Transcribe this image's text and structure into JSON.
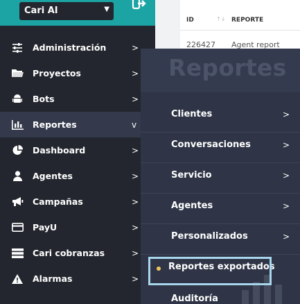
{
  "account": {
    "selected": "Cari AI"
  },
  "sidebar": {
    "items": [
      {
        "label": "Administración",
        "icon": "sliders-icon",
        "arrow": ">"
      },
      {
        "label": "Proyectos",
        "icon": "folder-icon",
        "arrow": ">"
      },
      {
        "label": "Bots",
        "icon": "android-icon",
        "arrow": ">"
      },
      {
        "label": "Reportes",
        "icon": "bar-chart-icon",
        "arrow": "v"
      },
      {
        "label": "Dashboard",
        "icon": "pie-chart-icon",
        "arrow": ">"
      },
      {
        "label": "Agentes",
        "icon": "user-icon",
        "arrow": ">"
      },
      {
        "label": "Campañas",
        "icon": "megaphone-icon",
        "arrow": ">"
      },
      {
        "label": "PayU",
        "icon": "credit-card-icon",
        "arrow": ">"
      },
      {
        "label": "Cari cobranzas",
        "icon": "server-icon",
        "arrow": ">"
      },
      {
        "label": "Alarmas",
        "icon": "warning-icon",
        "arrow": ">"
      }
    ]
  },
  "table": {
    "col_id": "ID",
    "col_reporte": "REPORTE",
    "sort_glyph": "↑↓",
    "row": {
      "id": "226427",
      "reporte": "Agent report"
    }
  },
  "submenu": {
    "title": "Reportes",
    "items": [
      {
        "label": "Clientes",
        "arrow": ">"
      },
      {
        "label": "Conversaciones",
        "arrow": ">"
      },
      {
        "label": "Servicio",
        "arrow": ">"
      },
      {
        "label": "Agentes",
        "arrow": ">"
      },
      {
        "label": "Personalizados",
        "arrow": ">"
      },
      {
        "label": "Reportes exportados",
        "arrow": ""
      },
      {
        "label": "Auditoría",
        "arrow": ""
      }
    ]
  },
  "colors": {
    "sidebar_bg": "#23262e",
    "brand_teal": "#1ba4a3",
    "submenu_bg": "#2f3546",
    "highlight_border": "#a8d6ec",
    "dot": "#f0c75e"
  }
}
